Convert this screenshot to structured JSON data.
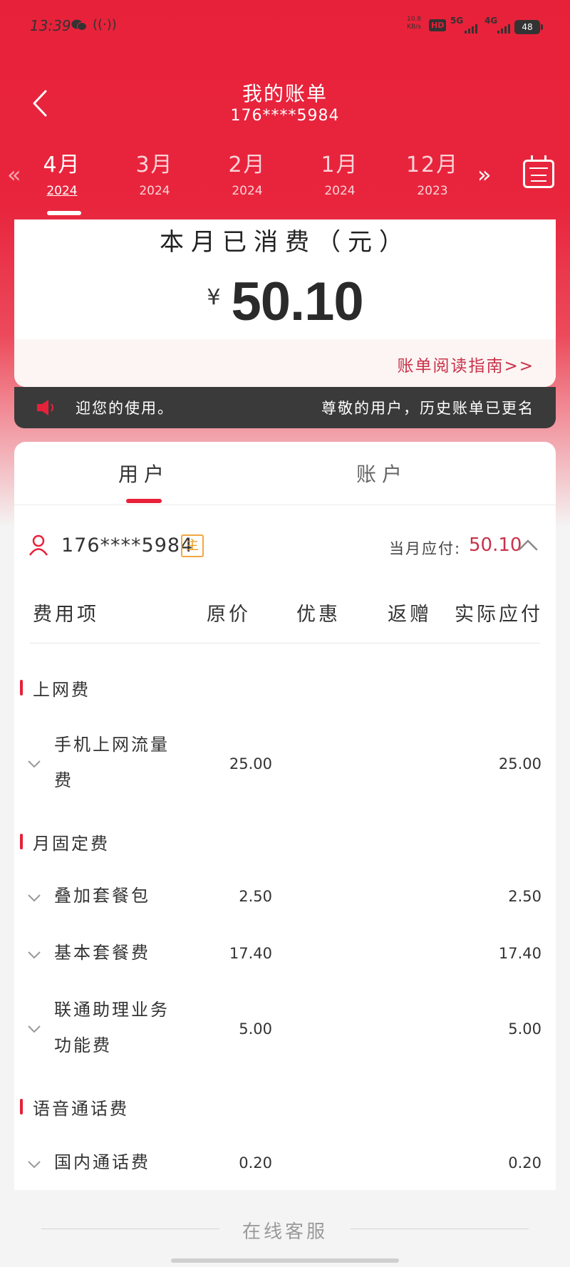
{
  "status_bar": {
    "time": "13:39",
    "net_speed": "10.8 KB/s",
    "hd": "HD",
    "sim1": "5G",
    "sim2": "4G",
    "battery": "48"
  },
  "header": {
    "title": "我的账单",
    "phone": "176****5984"
  },
  "months": [
    {
      "month": "4月",
      "year": "2024",
      "active": true
    },
    {
      "month": "3月",
      "year": "2024"
    },
    {
      "month": "2月",
      "year": "2024"
    },
    {
      "month": "1月",
      "year": "2024"
    },
    {
      "month": "12月",
      "year": "2023"
    }
  ],
  "summary": {
    "label": "本月已消费（元）",
    "currency": "¥",
    "amount": "50.10",
    "guide_link": "账单阅读指南>>"
  },
  "notice": {
    "left": "迎您的使用。",
    "right": "尊敬的用户，历史账单已更名"
  },
  "tabs": {
    "user": "用户",
    "account": "账户"
  },
  "user_row": {
    "phone": "176****5984",
    "badge": "主",
    "due_label": "当月应付:",
    "due_value": "50.10"
  },
  "table_headers": {
    "item": "费用项",
    "original": "原价",
    "discount": "优惠",
    "gift": "返赠",
    "payable": "实际应付"
  },
  "sections": [
    {
      "label": "上网费"
    },
    {
      "label": "月固定费"
    },
    {
      "label": "语音通话费"
    }
  ],
  "items": [
    {
      "name": "手机上网流量费",
      "original": "25.00",
      "payable": "25.00"
    },
    {
      "name": "叠加套餐包",
      "original": "2.50",
      "payable": "2.50"
    },
    {
      "name": "基本套餐费",
      "original": "17.40",
      "payable": "17.40"
    },
    {
      "name": "联通助理业务功能费",
      "original": "5.00",
      "payable": "5.00"
    },
    {
      "name": "国内通话费",
      "original": "0.20",
      "payable": "0.20"
    }
  ],
  "footer": {
    "service": "在线客服"
  },
  "colors": {
    "brand_red": "#e8213a",
    "accent_text": "#c8324a",
    "badge_orange": "#f0a840"
  }
}
